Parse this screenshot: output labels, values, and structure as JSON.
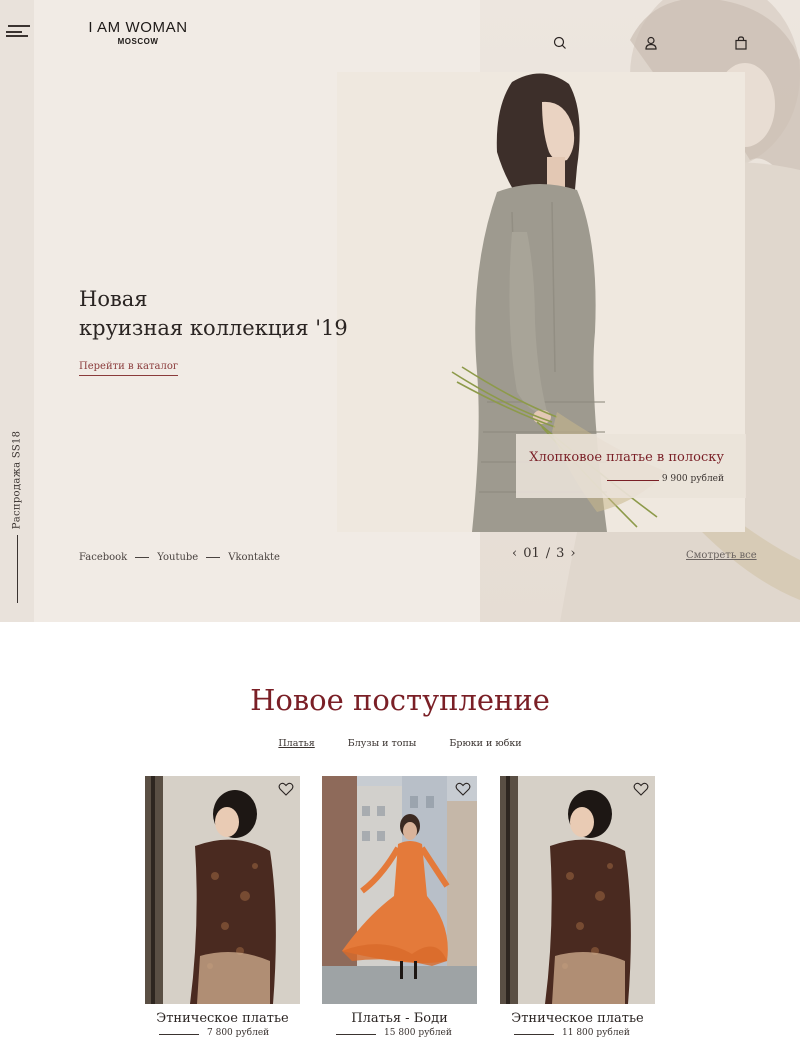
{
  "brand": {
    "name": "I AM WOMAN",
    "city": "MOSCOW"
  },
  "sidebar": {
    "promo_vertical": "Распродажа SS18"
  },
  "hero": {
    "title_line1": "Новая",
    "title_line2": "круизная коллекция '19",
    "catalog_link": "Перейти в каталог",
    "product": {
      "name": "Хлопковое платье в полоску",
      "price": "9 900 рублей"
    },
    "socials": [
      "Facebook",
      "Youtube",
      "Vkontakte"
    ],
    "pager": {
      "prev": "‹",
      "current": "01",
      "separator": "/",
      "total": "3",
      "next": "›"
    },
    "see_all": "Смотреть все"
  },
  "header_icons": [
    "search-icon",
    "user-icon",
    "bag-icon"
  ],
  "new_arrivals": {
    "title": "Новое поступление",
    "tabs": [
      {
        "label": "Платья",
        "active": true
      },
      {
        "label": "Блузы и топы",
        "active": false
      },
      {
        "label": "Брюки и юбки",
        "active": false
      }
    ],
    "products": [
      {
        "name": "Этническое платье",
        "price": "7 800 рублей"
      },
      {
        "name": "Платья - Боди",
        "price": "15 800 рублей"
      },
      {
        "name": "Этническое платье",
        "price": "11 800 рублей"
      }
    ]
  },
  "colors": {
    "accent": "#7a1f26",
    "hero_bg": "#f1ebe5",
    "strip": "#e9e2db"
  }
}
